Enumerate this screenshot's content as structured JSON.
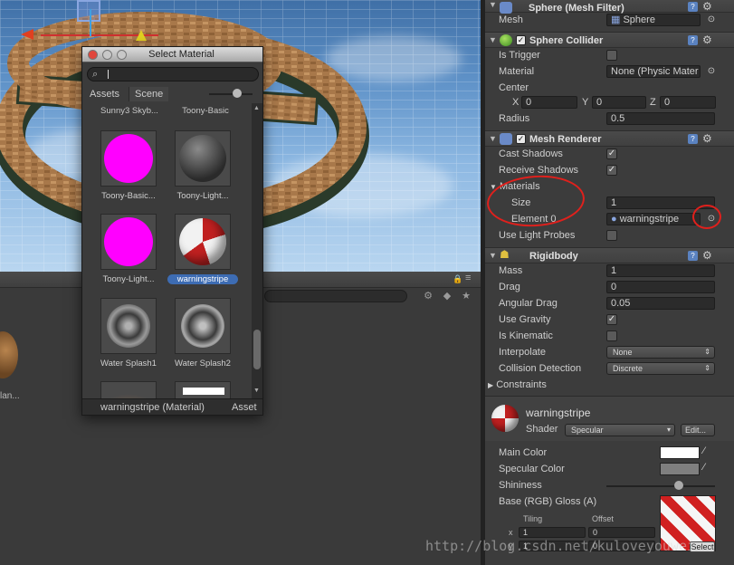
{
  "inspector": {
    "mesh_filter": {
      "title": "Sphere (Mesh Filter)",
      "mesh_label": "Mesh",
      "mesh_value": "Sphere"
    },
    "sphere_collider": {
      "title": "Sphere Collider",
      "is_trigger": "Is Trigger",
      "material_label": "Material",
      "material_value": "None (Physic Mater",
      "center_label": "Center",
      "x_label": "X",
      "x_value": "0",
      "y_label": "Y",
      "y_value": "0",
      "z_label": "Z",
      "z_value": "0",
      "radius_label": "Radius",
      "radius_value": "0.5"
    },
    "mesh_renderer": {
      "title": "Mesh Renderer",
      "cast_shadows": "Cast Shadows",
      "receive_shadows": "Receive Shadows",
      "materials_label": "Materials",
      "size_label": "Size",
      "size_value": "1",
      "element0_label": "Element 0",
      "element0_value": "warningstripe",
      "light_probes": "Use Light Probes"
    },
    "rigidbody": {
      "title": "Rigidbody",
      "mass_label": "Mass",
      "mass_value": "1",
      "drag_label": "Drag",
      "drag_value": "0",
      "ang_drag_label": "Angular Drag",
      "ang_drag_value": "0.05",
      "use_gravity": "Use Gravity",
      "is_kinematic": "Is Kinematic",
      "interpolate_label": "Interpolate",
      "interpolate_value": "None",
      "collision_label": "Collision Detection",
      "collision_value": "Discrete",
      "constraints_label": "Constraints"
    },
    "material": {
      "name": "warningstripe",
      "shader_label": "Shader",
      "shader_value": "Specular",
      "edit_button": "Edit...",
      "main_color": "Main Color",
      "spec_color": "Specular Color",
      "shininess": "Shininess",
      "base_label": "Base (RGB) Gloss (A)",
      "tiling_label": "Tiling",
      "offset_label": "Offset",
      "tiling_x": "1",
      "offset_x": "0",
      "tiling_y": "1",
      "offset_y": "0",
      "select_button": "Select"
    }
  },
  "dialog": {
    "title": "Select Material",
    "search_value": "",
    "tab_assets": "Assets",
    "tab_scene": "Scene",
    "top_labels": [
      "Sunny3 Skyb...",
      "Toony-Basic"
    ],
    "items": [
      {
        "label": "Toony-Basic...",
        "kind": "magenta"
      },
      {
        "label": "Toony-Light...",
        "kind": "dark"
      },
      {
        "label": "Toony-Light...",
        "kind": "magenta"
      },
      {
        "label": "warningstripe",
        "kind": "stripe",
        "selected": true
      },
      {
        "label": "Water Splash1",
        "kind": "splash"
      },
      {
        "label": "Water Splash2",
        "kind": "splash"
      }
    ],
    "footer_left": "warningstripe (Material)",
    "footer_right": "Asset"
  },
  "project": {
    "thumb_label": "lan..."
  },
  "watermark": "http://blog.csdn.net/kuloveyouwei",
  "colors": {
    "annotation_red": "#e0201c",
    "selection_blue": "#3d6cb3",
    "magenta": "#ff00ff"
  }
}
